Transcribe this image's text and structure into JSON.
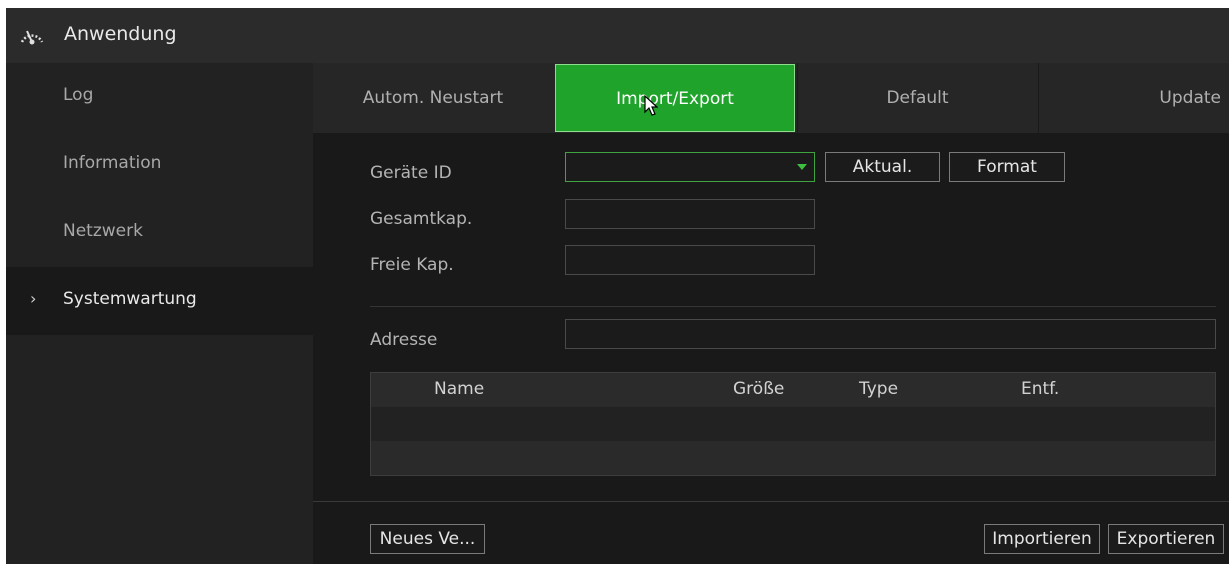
{
  "window": {
    "title": "Anwendung",
    "icon": "speedometer-icon"
  },
  "sidebar": {
    "items": [
      {
        "label": "Log",
        "active": false
      },
      {
        "label": "Information",
        "active": false
      },
      {
        "label": "Netzwerk",
        "active": false
      },
      {
        "label": "Systemwartung",
        "active": true,
        "marker": "›"
      }
    ]
  },
  "tabs": [
    {
      "label": "Autom. Neustart",
      "active": false
    },
    {
      "label": "Import/Export",
      "active": true
    },
    {
      "label": "Default",
      "active": false
    },
    {
      "label": "Update",
      "active": false
    }
  ],
  "form": {
    "device_id_label": "Geräte ID",
    "device_id_value": "",
    "refresh_label": "Aktual.",
    "format_label": "Format",
    "total_capacity_label": "Gesamtkap.",
    "total_capacity_value": "",
    "free_capacity_label": "Freie Kap.",
    "free_capacity_value": "",
    "address_label": "Adresse",
    "address_value": ""
  },
  "table": {
    "columns": [
      "Name",
      "Größe",
      "Type",
      "Entf."
    ],
    "rows": []
  },
  "footer": {
    "new_folder_label": "Neues Ve...",
    "import_label": "Importieren",
    "export_label": "Exportieren"
  },
  "colors": {
    "accent_green": "#1fa32a",
    "background": "#191919",
    "sidebar": "#222222",
    "titlebar": "#2b2b2b"
  }
}
